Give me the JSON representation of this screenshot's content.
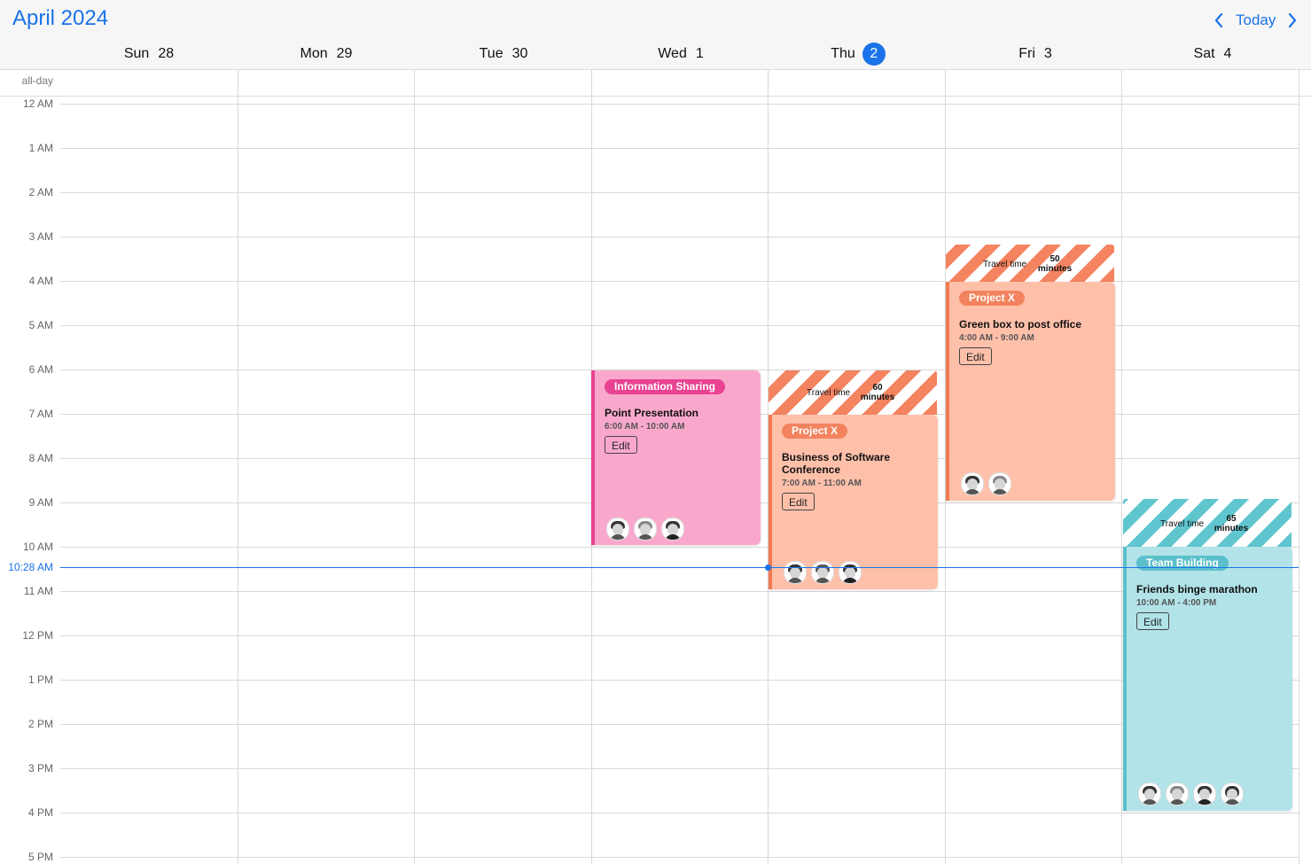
{
  "header": {
    "month_title": "April 2024",
    "today_label": "Today",
    "prev_icon": "chevron-left-icon",
    "next_icon": "chevron-right-icon",
    "accent_color": "#1a73e8"
  },
  "days": [
    {
      "name": "Sun",
      "num": "28",
      "today": false
    },
    {
      "name": "Mon",
      "num": "29",
      "today": false
    },
    {
      "name": "Tue",
      "num": "30",
      "today": false
    },
    {
      "name": "Wed",
      "num": "1",
      "today": false
    },
    {
      "name": "Thu",
      "num": "2",
      "today": true
    },
    {
      "name": "Fri",
      "num": "3",
      "today": false
    },
    {
      "name": "Sat",
      "num": "4",
      "today": false
    }
  ],
  "allday_label": "all-day",
  "hours": [
    "12 AM",
    "1 AM",
    "2 AM",
    "3 AM",
    "4 AM",
    "5 AM",
    "6 AM",
    "7 AM",
    "8 AM",
    "9 AM",
    "10 AM",
    "11 AM",
    "12 PM",
    "1 PM",
    "2 PM",
    "3 PM",
    "4 PM",
    "5 PM"
  ],
  "current_time": "10:28 AM",
  "events": [
    {
      "tag": "Information Sharing",
      "title": "Point Presentation",
      "time": "6:00 AM - 10:00 AM",
      "edit_label": "Edit",
      "color": "pink",
      "attendees": 3
    },
    {
      "tag": "Project X",
      "title": "Business of Software Conference",
      "time": "7:00 AM - 11:00 AM",
      "edit_label": "Edit",
      "color": "salmon",
      "travel_label": "Travel time",
      "travel_value": "60 minutes",
      "attendees": 3
    },
    {
      "tag": "Project X",
      "title": "Green box to post office",
      "time": "4:00 AM - 9:00 AM",
      "edit_label": "Edit",
      "color": "salmon",
      "travel_label": "Travel time",
      "travel_value": "50 minutes",
      "attendees": 2
    },
    {
      "tag": "Team Building",
      "title": "Friends binge marathon",
      "time": "10:00 AM - 4:00 PM",
      "edit_label": "Edit",
      "color": "teal",
      "travel_label": "Travel time",
      "travel_value": "65 minutes",
      "attendees": 4
    }
  ],
  "colors": {
    "pink": "#e84392",
    "salmon": "#f27a52",
    "teal": "#5cc0ca",
    "today_badge": "#1a73e8"
  }
}
